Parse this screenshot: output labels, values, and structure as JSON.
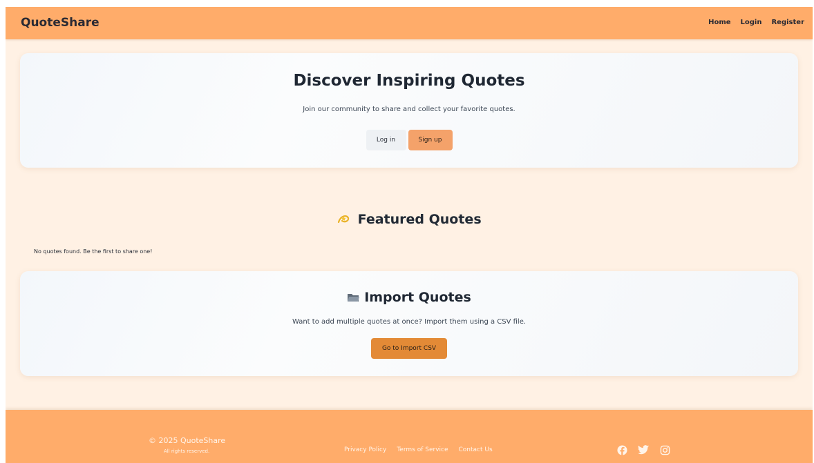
{
  "header": {
    "brand": "QuoteShare",
    "nav": [
      {
        "label": "Home"
      },
      {
        "label": "Login"
      },
      {
        "label": "Register"
      }
    ]
  },
  "hero": {
    "title": "Discover Inspiring Quotes",
    "subtitle": "Join our community to share and collect your favorite quotes.",
    "login_label": "Log in",
    "signup_label": "Sign up"
  },
  "featured": {
    "icon": "dizzy-star-icon",
    "title": "Featured Quotes",
    "empty_message": "No quotes found. Be the first to share one!"
  },
  "import": {
    "icon": "folder-icon",
    "title": "Import Quotes",
    "description": "Want to add multiple quotes at once? Import them using a CSV file.",
    "button_label": "Go to Import CSV"
  },
  "footer": {
    "copyright": "© 2025 QuoteShare",
    "rights": "All rights reserved.",
    "links": [
      {
        "label": "Privacy Policy"
      },
      {
        "label": "Terms of Service"
      },
      {
        "label": "Contact Us"
      }
    ],
    "social": [
      "facebook-icon",
      "twitter-icon",
      "instagram-icon"
    ]
  },
  "colors": {
    "header_bg": "#ffac6a",
    "page_bg": "#fff1e4",
    "signup_button": "#f4a26a",
    "import_button": "#e38a36"
  }
}
